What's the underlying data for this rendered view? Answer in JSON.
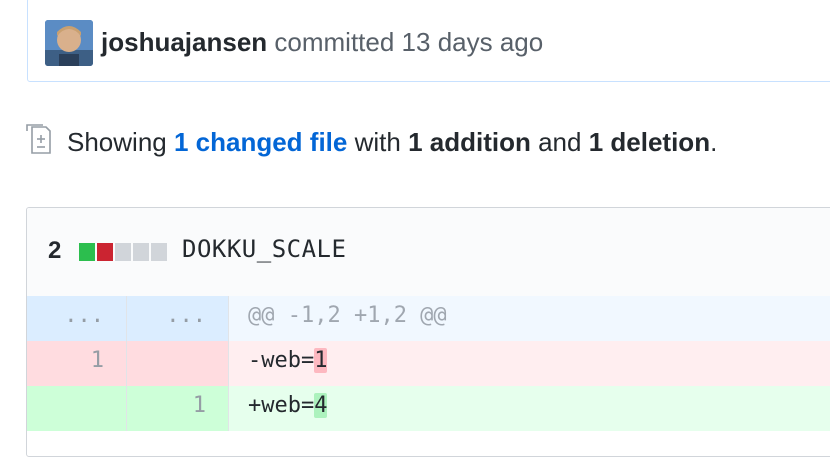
{
  "commit": {
    "author": "joshuajansen",
    "action": "committed",
    "time": "13 days ago"
  },
  "summary": {
    "prefix": "Showing",
    "changed_link": "1 changed file",
    "with": "with",
    "additions": "1 addition",
    "and": "and",
    "deletions": "1 deletion",
    "end": "."
  },
  "file": {
    "diffstat_count": "2",
    "diffstat_blocks": [
      "added",
      "deleted",
      "neutral",
      "neutral",
      "neutral"
    ],
    "name": "DOKKU_SCALE",
    "rows": [
      {
        "type": "hunk",
        "old": "...",
        "new": "...",
        "code": "@@ -1,2 +1,2 @@"
      },
      {
        "type": "del",
        "old": "1",
        "new": "",
        "prefix": "-web=",
        "changed": "1"
      },
      {
        "type": "add",
        "old": "",
        "new": "1",
        "prefix": "+web=",
        "changed": "4"
      }
    ]
  },
  "colors": {
    "added": "#2cbe4e",
    "deleted": "#cb2431",
    "neutral": "#d1d5da",
    "link": "#0366d6"
  }
}
